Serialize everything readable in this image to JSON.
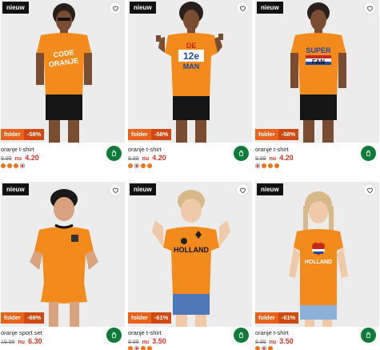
{
  "products": [
    {
      "badge": "nieuw",
      "promo_label": "folder",
      "discount": "-58%",
      "title": "oranje t-shirt",
      "old_price": "9.99",
      "nu": "nu",
      "price": "4.20",
      "shirt_text": "CODE ORANJE",
      "swatches": [
        "orange",
        "orange",
        "orange",
        "flag"
      ]
    },
    {
      "badge": "nieuw",
      "promo_label": "folder",
      "discount": "-58%",
      "title": "oranje t-shirt",
      "old_price": "9.99",
      "nu": "nu",
      "price": "4.20",
      "shirt_text": "DE 12e MAN",
      "swatches": [
        "orange",
        "flag",
        "orange",
        "orange"
      ]
    },
    {
      "badge": "nieuw",
      "promo_label": "folder",
      "discount": "-58%",
      "title": "oranje t-shirt",
      "old_price": "9.99",
      "nu": "nu",
      "price": "4.20",
      "shirt_text": "SUPER FAN",
      "swatches": [
        "flag",
        "orange",
        "orange",
        "orange"
      ]
    },
    {
      "badge": "nieuw",
      "promo_label": "folder",
      "discount": "-68%",
      "title": "oranje sport set",
      "old_price": "19.99",
      "nu": "nu",
      "price": "6.30",
      "shirt_text": "",
      "swatches": [
        "orange",
        "orange"
      ]
    },
    {
      "badge": "nieuw",
      "promo_label": "folder",
      "discount": "-61%",
      "title": "oranje t-shirt",
      "old_price": "8.99",
      "nu": "nu",
      "price": "3.50",
      "shirt_text": "HOLLAND",
      "swatches": [
        "orange",
        "flag",
        "orange",
        "orange"
      ]
    },
    {
      "badge": "nieuw",
      "promo_label": "folder",
      "discount": "-61%",
      "title": "oranje t-shirt",
      "old_price": "8.99",
      "nu": "nu",
      "price": "3.50",
      "shirt_text": "HOLLAND",
      "swatches": [
        "orange",
        "flag",
        "orange"
      ]
    }
  ],
  "colors": {
    "promo": "#e8621a",
    "price": "#d4322a",
    "cart": "#0f7a3a",
    "shirt": "#f28a1c"
  }
}
